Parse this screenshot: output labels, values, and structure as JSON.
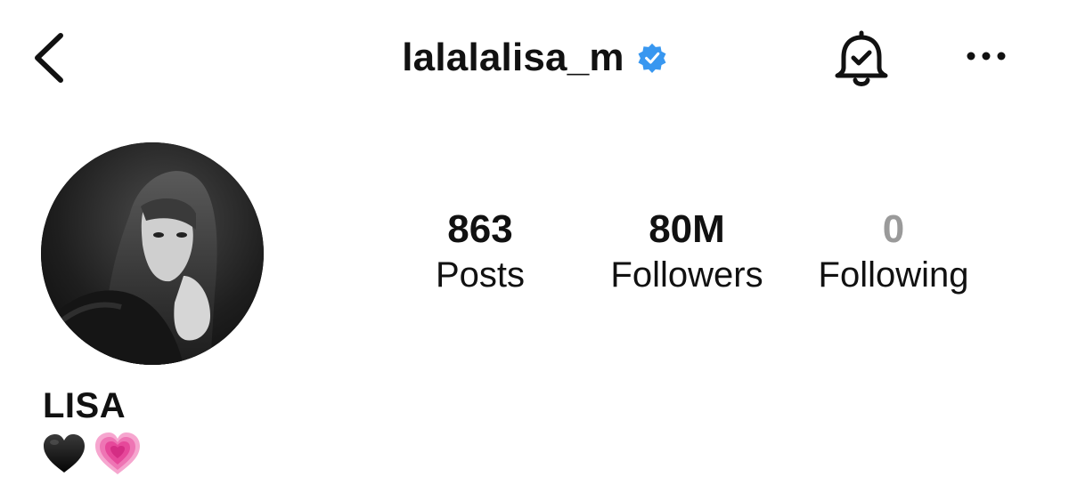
{
  "header": {
    "username": "lalalalisa_m",
    "icons": {
      "back": "chevron-left-icon",
      "verified": "verified-badge-icon",
      "notifications": "bell-check-icon",
      "more": "more-horizontal-icon"
    },
    "accent_color": "#3897f0"
  },
  "profile": {
    "display_name": "LISA",
    "bio_emojis": [
      "black-heart-icon",
      "growing-heart-icon"
    ]
  },
  "stats": {
    "posts": {
      "value": "863",
      "label": "Posts"
    },
    "followers": {
      "value": "80M",
      "label": "Followers"
    },
    "following": {
      "value": "0",
      "label": "Following"
    }
  }
}
